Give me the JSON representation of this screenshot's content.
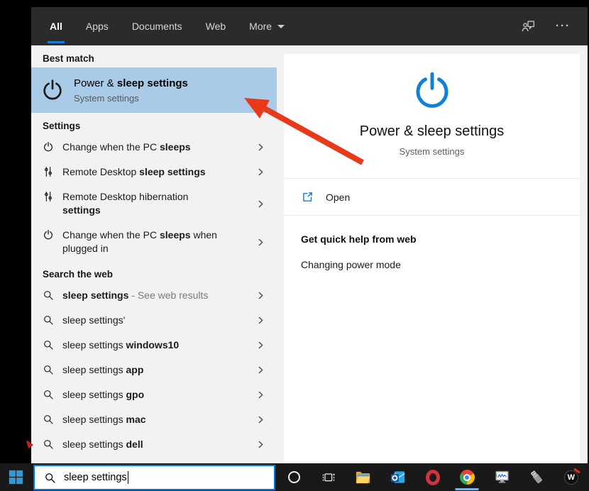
{
  "topbar": {
    "tabs": [
      {
        "label": "All",
        "active": true,
        "dropdown": false
      },
      {
        "label": "Apps",
        "active": false,
        "dropdown": false
      },
      {
        "label": "Documents",
        "active": false,
        "dropdown": false
      },
      {
        "label": "Web",
        "active": false,
        "dropdown": false
      },
      {
        "label": "More",
        "active": false,
        "dropdown": true
      }
    ],
    "feedback_icon": "account-feedback-icon",
    "ellipsis": "···"
  },
  "left": {
    "best_match_header": "Best match",
    "best_match": {
      "icon": "power-icon",
      "title_segments": [
        {
          "t": "Power & ",
          "b": false
        },
        {
          "t": "sleep settings",
          "b": true
        }
      ],
      "subtitle": "System settings"
    },
    "settings_header": "Settings",
    "settings_items": [
      {
        "icon": "power-icon",
        "segments": [
          {
            "t": "Change when the PC ",
            "b": false
          },
          {
            "t": "sleeps",
            "b": true
          }
        ]
      },
      {
        "icon": "tuner-icon",
        "segments": [
          {
            "t": "Remote Desktop ",
            "b": false
          },
          {
            "t": "sleep settings",
            "b": true
          }
        ]
      },
      {
        "icon": "tuner-icon",
        "segments": [
          {
            "t": "Remote Desktop hibernation ",
            "b": false
          },
          {
            "t": "settings",
            "b": true
          }
        ]
      },
      {
        "icon": "power-icon",
        "segments": [
          {
            "t": "Change when the PC ",
            "b": false
          },
          {
            "t": "sleeps",
            "b": true
          },
          {
            "t": " when plugged in",
            "b": false
          }
        ]
      }
    ],
    "web_header": "Search the web",
    "web_items": [
      {
        "icon": "search-icon",
        "segments": [
          {
            "t": "sleep settings",
            "b": true
          },
          {
            "t": " - See web results",
            "gray": true
          }
        ]
      },
      {
        "icon": "search-icon",
        "segments": [
          {
            "t": "sleep settings'",
            "b": false
          }
        ]
      },
      {
        "icon": "search-icon",
        "segments": [
          {
            "t": "sleep settings ",
            "b": false
          },
          {
            "t": "windows10",
            "b": true
          }
        ]
      },
      {
        "icon": "search-icon",
        "segments": [
          {
            "t": "sleep settings ",
            "b": false
          },
          {
            "t": "app",
            "b": true
          }
        ]
      },
      {
        "icon": "search-icon",
        "segments": [
          {
            "t": "sleep settings ",
            "b": false
          },
          {
            "t": "gpo",
            "b": true
          }
        ]
      },
      {
        "icon": "search-icon",
        "segments": [
          {
            "t": "sleep settings ",
            "b": false
          },
          {
            "t": "mac",
            "b": true
          }
        ]
      },
      {
        "icon": "search-icon",
        "segments": [
          {
            "t": "sleep settings ",
            "b": false
          },
          {
            "t": "dell",
            "b": true
          }
        ]
      }
    ]
  },
  "preview": {
    "icon": "power-icon-large",
    "title": "Power & sleep settings",
    "subtitle": "System settings",
    "open_label": "Open",
    "open_icon": "launch-icon",
    "help_header": "Get quick help from web",
    "help_link": "Changing power mode"
  },
  "taskbar": {
    "start_icon": "windows-start-icon",
    "search": {
      "icon": "search-icon",
      "value": "sleep settings"
    },
    "icons": [
      {
        "name": "cortana-ring-icon",
        "active": false
      },
      {
        "name": "task-view-icon",
        "active": false
      },
      {
        "name": "file-explorer-icon",
        "active": false
      },
      {
        "name": "outlook-icon",
        "active": false
      },
      {
        "name": "opera-icon",
        "active": false
      },
      {
        "name": "chrome-icon",
        "active": true
      },
      {
        "name": "system-monitor-icon",
        "active": false
      },
      {
        "name": "usb-drive-icon",
        "active": false
      },
      {
        "name": "w-badge-icon",
        "active": false
      }
    ]
  },
  "annotation": {
    "arrow_color": "#e8391b"
  },
  "colors": {
    "accent_blue": "#0078d7",
    "highlight_blue": "#a9cbe8",
    "topbar_bg": "#2b2b2b",
    "panel_bg": "#f2f2f2",
    "taskbar_bg": "#191919",
    "hero_icon_blue": "#1180d7"
  }
}
